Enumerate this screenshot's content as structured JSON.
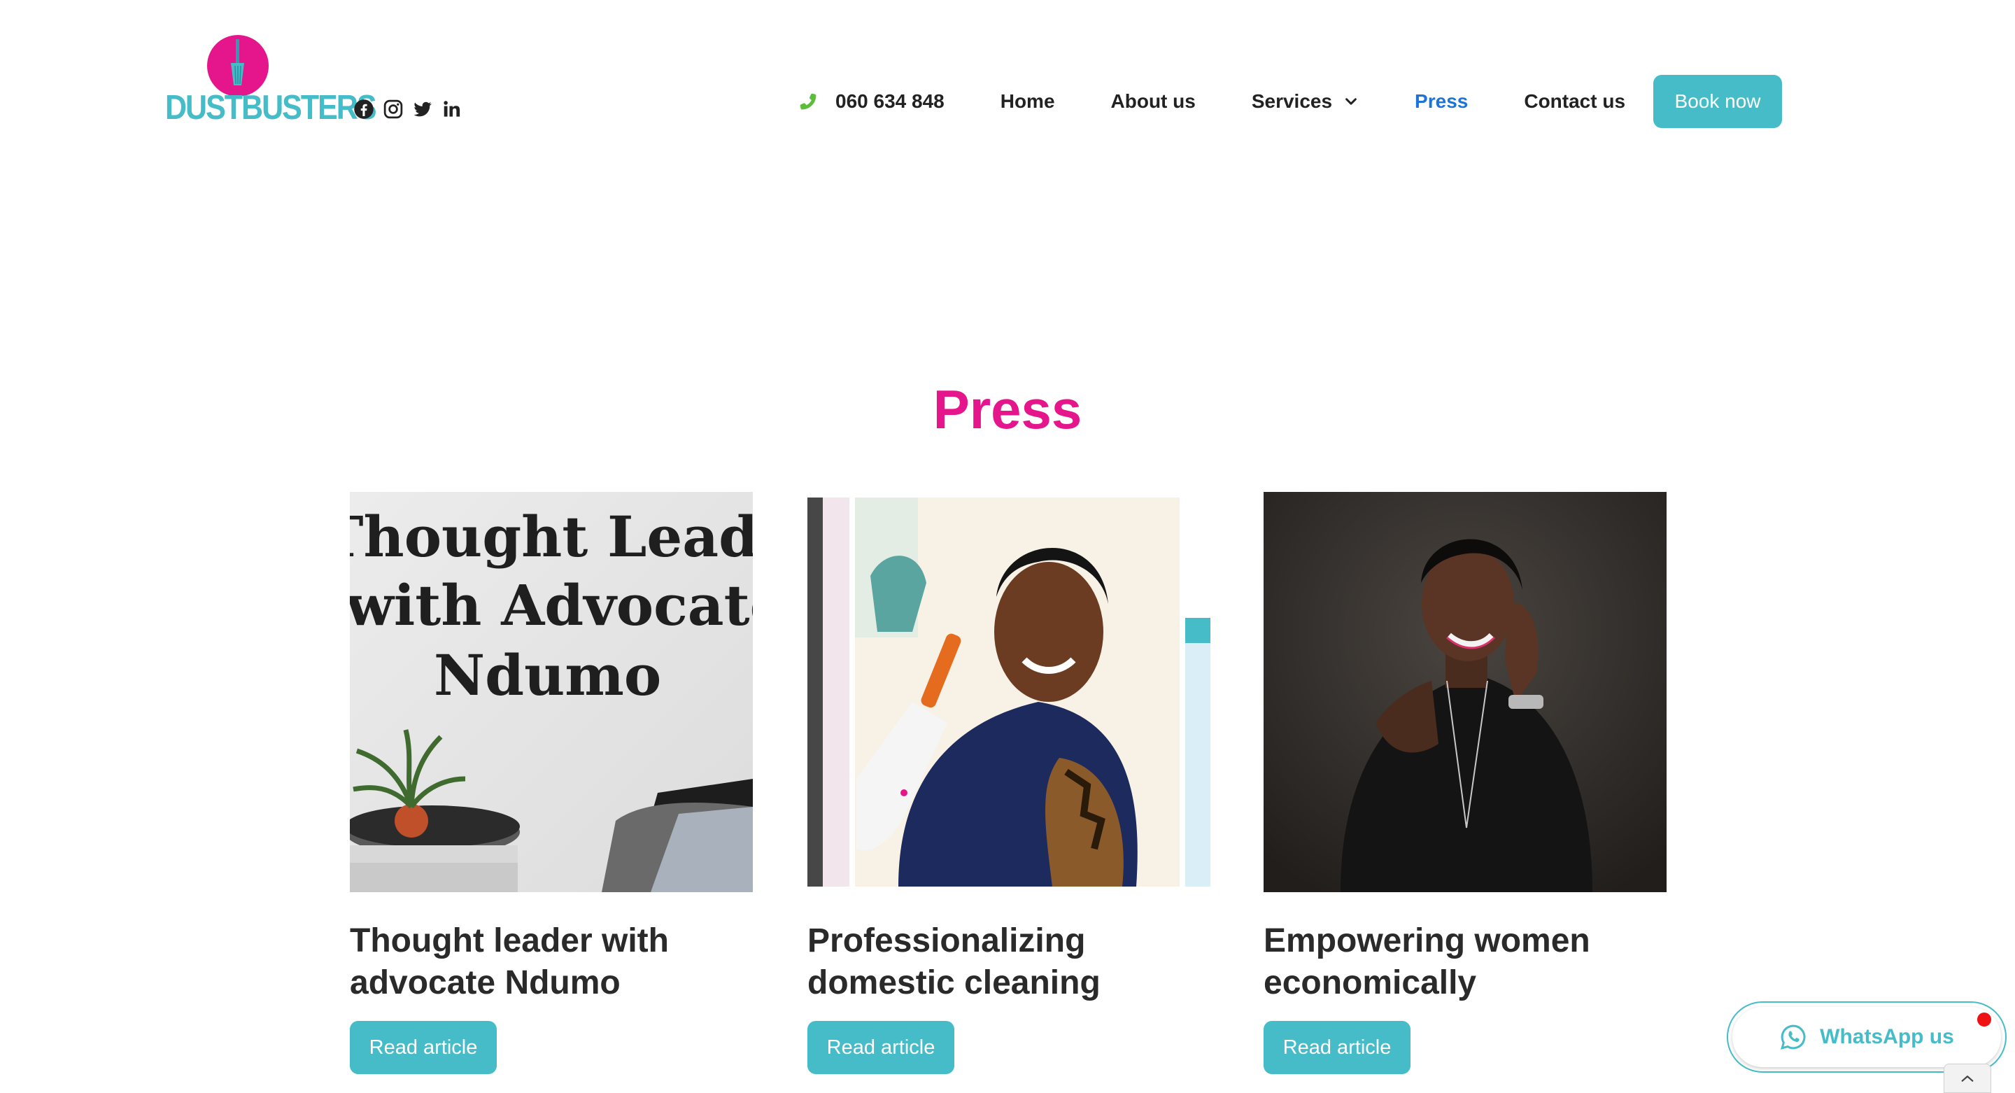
{
  "brand": {
    "name": "DUSTBUSTERS",
    "pink": "#e5168c",
    "teal": "#45bcc8"
  },
  "social": [
    "facebook-icon",
    "instagram-icon",
    "twitter-icon",
    "linkedin-icon"
  ],
  "nav": {
    "phone": "060 634 848",
    "items": [
      {
        "label": "Home"
      },
      {
        "label": "About us"
      },
      {
        "label": "Services"
      },
      {
        "label": "Press",
        "active": true
      },
      {
        "label": "Contact us"
      }
    ],
    "cta": "Book now"
  },
  "page": {
    "title": "Press"
  },
  "cards": [
    {
      "image_text": [
        "Thought Leader",
        "with Advocate",
        "Ndumo"
      ],
      "title_line1": "Thought leader with",
      "title_line2": "advocate Ndumo",
      "button": "Read article"
    },
    {
      "title_line1": "Professionalizing",
      "title_line2": "domestic cleaning",
      "button": "Read article"
    },
    {
      "title_line1": "Empowering women",
      "title_line2": "economically",
      "button": "Read article"
    }
  ],
  "whatsapp": {
    "label": "WhatsApp us"
  }
}
